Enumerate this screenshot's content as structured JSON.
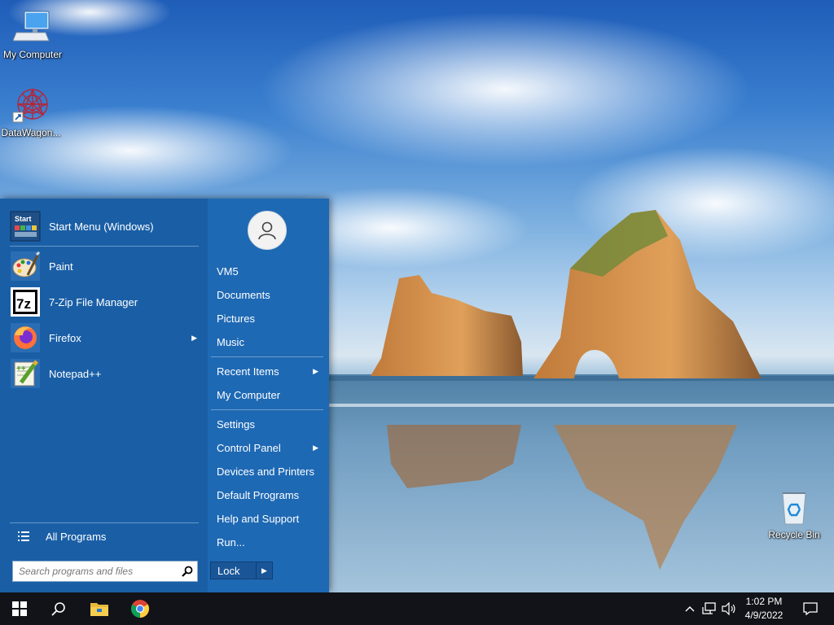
{
  "desktop": {
    "icons": [
      {
        "label": "My Computer",
        "icon": "computer-icon"
      },
      {
        "label": "DataWagon...",
        "icon": "datawagon-shortcut-icon"
      },
      {
        "label": "Recycle Bin",
        "icon": "recycle-bin-icon"
      }
    ]
  },
  "start_menu": {
    "pinned": [
      {
        "label": "Start Menu (Windows)",
        "icon": "start-menu-settings-icon"
      },
      {
        "label": "Paint",
        "icon": "paint-icon"
      },
      {
        "label": "7-Zip File Manager",
        "icon": "7zip-icon"
      },
      {
        "label": "Firefox",
        "icon": "firefox-icon",
        "submenu": true
      },
      {
        "label": "Notepad++",
        "icon": "notepad-plus-plus-icon"
      }
    ],
    "all_programs": "All Programs",
    "search_placeholder": "Search programs and files",
    "right": {
      "user": "VM5",
      "items": [
        "Documents",
        "Pictures",
        "Music",
        "Recent Items",
        "My Computer",
        "Settings",
        "Control Panel",
        "Devices and Printers",
        "Default Programs",
        "Help and Support",
        "Run..."
      ],
      "lock": "Lock"
    }
  },
  "taskbar": {
    "apps": [
      "start-icon",
      "search-icon",
      "file-explorer-icon",
      "chrome-icon"
    ],
    "clock": {
      "time": "1:02 PM",
      "date": "4/9/2022"
    }
  }
}
